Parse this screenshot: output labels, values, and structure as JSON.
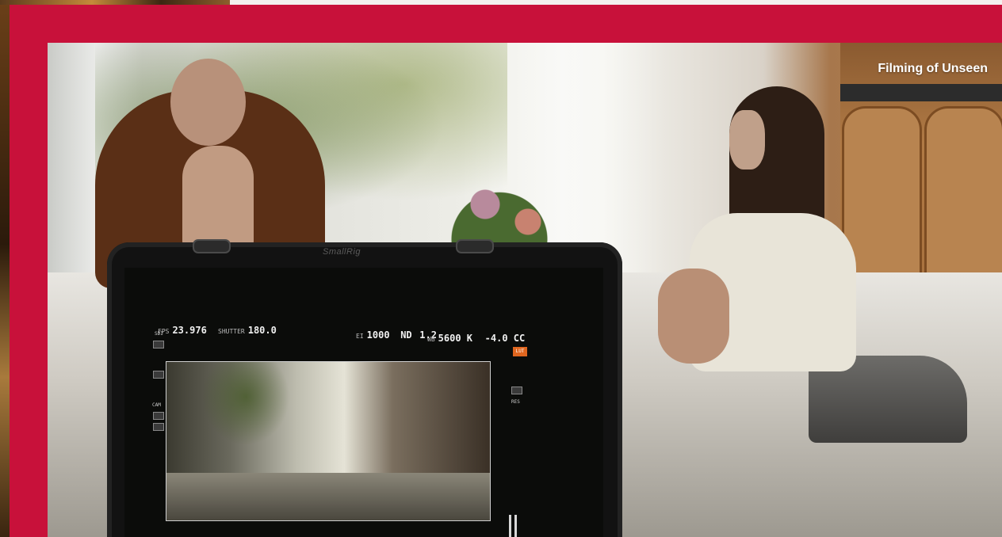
{
  "caption": {
    "text": "Filming of Unseen"
  },
  "monitor": {
    "brand": "SmallRig",
    "fps": {
      "label": "FPS",
      "value": "23.976"
    },
    "shutter": {
      "label": "SHUTTER",
      "value": "180.0"
    },
    "ei": {
      "label": "EI",
      "value": "1000"
    },
    "nd": {
      "label": "ND",
      "value": "1.2"
    },
    "wb": {
      "label": "WB",
      "value": "5600 K"
    },
    "cc": {
      "value": "-4.0 CC"
    },
    "lut_badge": "LUT",
    "side_labels": {
      "sdi": "SDI",
      "cam": "CAM",
      "res": "RES"
    }
  },
  "colors": {
    "frame_red": "#c8113a",
    "lut_orange": "#e0661f"
  }
}
